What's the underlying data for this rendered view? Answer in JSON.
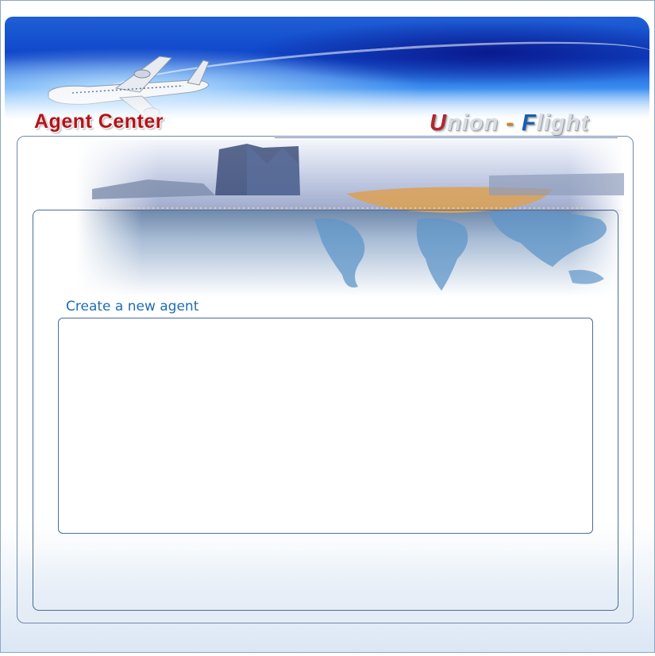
{
  "header": {
    "title": "Agent Center",
    "brand": {
      "u": "U",
      "nion": "nion",
      "dash": "-",
      "f": "F",
      "light": "light"
    }
  },
  "main": {
    "section_heading": "Create a new agent"
  },
  "colors": {
    "title_red": "#b3141b",
    "heading_blue": "#1f6cb3",
    "panel_border": "#4e6a9e"
  }
}
